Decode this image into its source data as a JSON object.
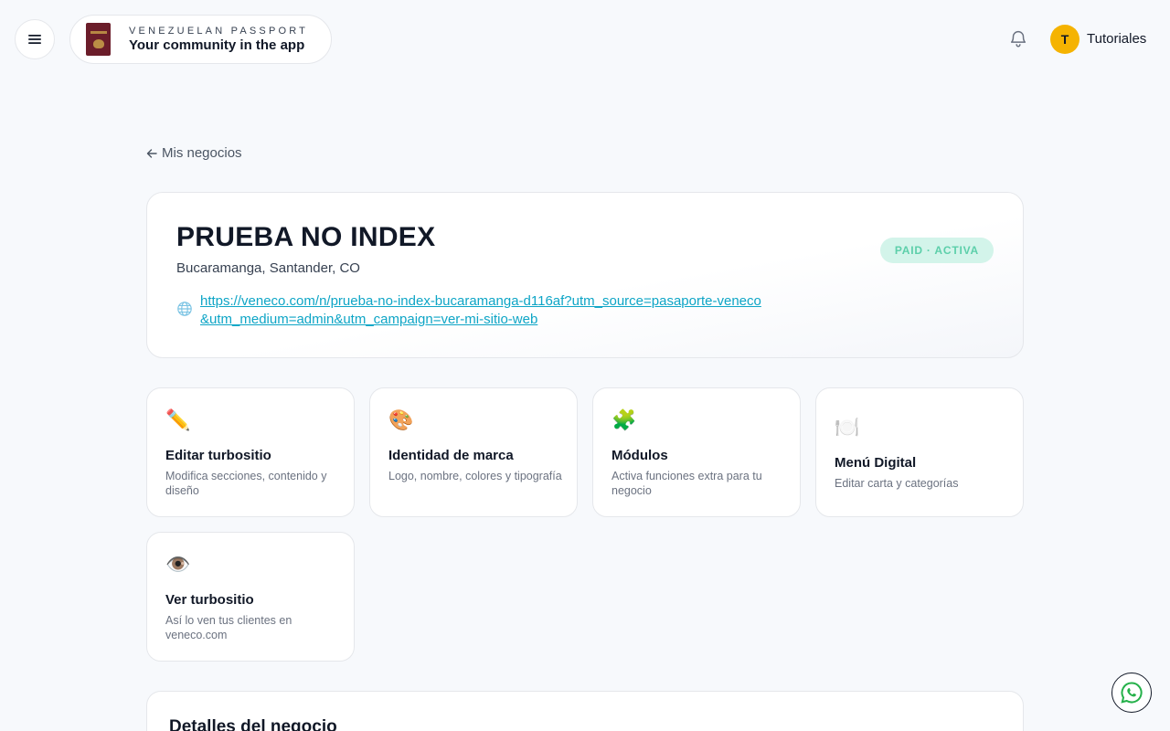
{
  "header": {
    "brand_eyebrow": "VENEZUELAN PASSPORT",
    "brand_tagline": "Your community in the app",
    "user_initial": "T",
    "user_name": "Tutoriales"
  },
  "back_link": {
    "label": "Mis negocios"
  },
  "business": {
    "name": "PRUEBA NO INDEX",
    "location": "Bucaramanga, Santander, CO",
    "url": "https://veneco.com/n/prueba-no-index-bucaramanga-d116af?utm_source=pasaporte-veneco&utm_medium=admin&utm_campaign=ver-mi-sitio-web",
    "status": "PAID · ACTIVA"
  },
  "actions": [
    {
      "icon": "✏️",
      "title": "Editar turbositio",
      "description": "Modifica secciones, contenido y diseño"
    },
    {
      "icon": "🎨",
      "title": "Identidad de marca",
      "description": "Logo, nombre, colores y tipografía"
    },
    {
      "icon": "🧩",
      "title": "Módulos",
      "description": "Activa funciones extra para tu negocio"
    },
    {
      "icon": "🍽️",
      "title": "Menú Digital",
      "description": "Editar carta y categorías"
    },
    {
      "icon": "👁️",
      "title": "Ver turbositio",
      "description": "Así lo ven tus clientes en veneco.com"
    }
  ],
  "details": {
    "title": "Detalles del negocio"
  },
  "colors": {
    "accent_link": "#0ea5c6",
    "status_bg": "#d3f4ea",
    "status_text": "#5ccfaa",
    "avatar_bg": "#f5b301"
  }
}
